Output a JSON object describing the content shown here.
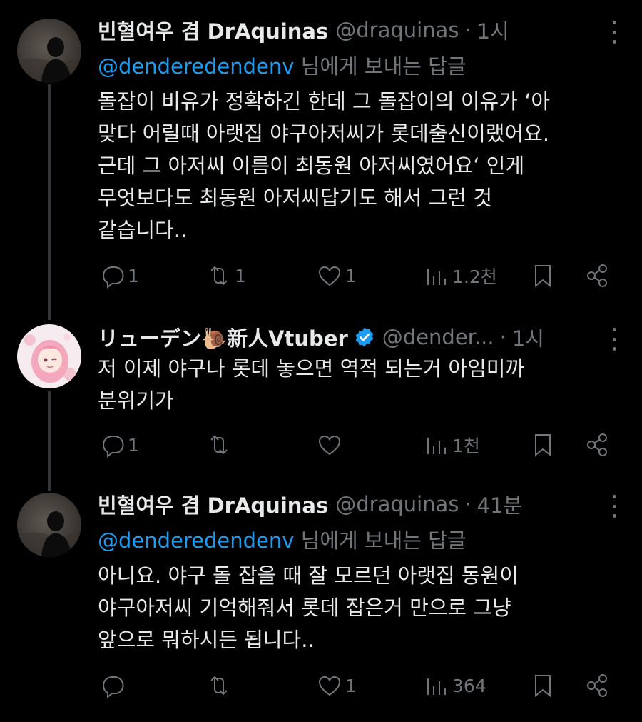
{
  "tweets": [
    {
      "name": "빈혈여우 겸 DrAquinas",
      "handle": "@draquinas",
      "dot": "·",
      "time": "1시",
      "replying_mention": "@denderedendenv",
      "replying_suffix": " 님에게 보내는 답글",
      "lines": [
        "돌잡이 비유가 정확하긴 한데 그 돌잡이의 이유가 ‘아",
        "맞다 어릴때 아랫집 야구아저씨가 롯데출신이랬어요.",
        "근데 그 아저씨 이름이 최동원 아저씨였어요‘ 인게",
        "무엇보다도 최동원 아저씨답기도 해서 그런 것",
        "같습니다.."
      ],
      "replies": "1",
      "retweets": "1",
      "likes": "1",
      "views": "1.2천"
    },
    {
      "name": "リューデン🐌新人Vtuber",
      "handle": "@dender...",
      "dot": "·",
      "time": "1시",
      "lines": [
        "저 이제 야구나 롯데 놓으면 역적 되는거 아임미까",
        "분위기가"
      ],
      "replies": "1",
      "retweets": "",
      "likes": "",
      "views": "1천"
    },
    {
      "name": "빈혈여우 겸 DrAquinas",
      "handle": "@draquinas",
      "dot": "·",
      "time": "41분",
      "replying_mention": "@denderedendenv",
      "replying_suffix": " 님에게 보내는 답글",
      "lines": [
        "아니요. 야구 돌 잡을 때 잘 모르던 아랫집 동원이",
        "야구아저씨 기억해줘서 롯데 잡은거 만으로 그냥",
        "앞으로 뭐하시든 됩니다.."
      ],
      "replies": "",
      "retweets": "",
      "likes": "1",
      "views": "364"
    }
  ],
  "icons": {
    "reply": "reply-icon",
    "retweet": "retweet-icon",
    "like": "heart-icon",
    "views": "views-icon",
    "bookmark": "bookmark-icon",
    "share": "share-icon",
    "more": "more-icon",
    "verified": "verified-badge-icon"
  },
  "colors": {
    "background": "#000000",
    "text": "#e7e9ea",
    "secondary": "#71767b",
    "link": "#1d9bf0"
  }
}
